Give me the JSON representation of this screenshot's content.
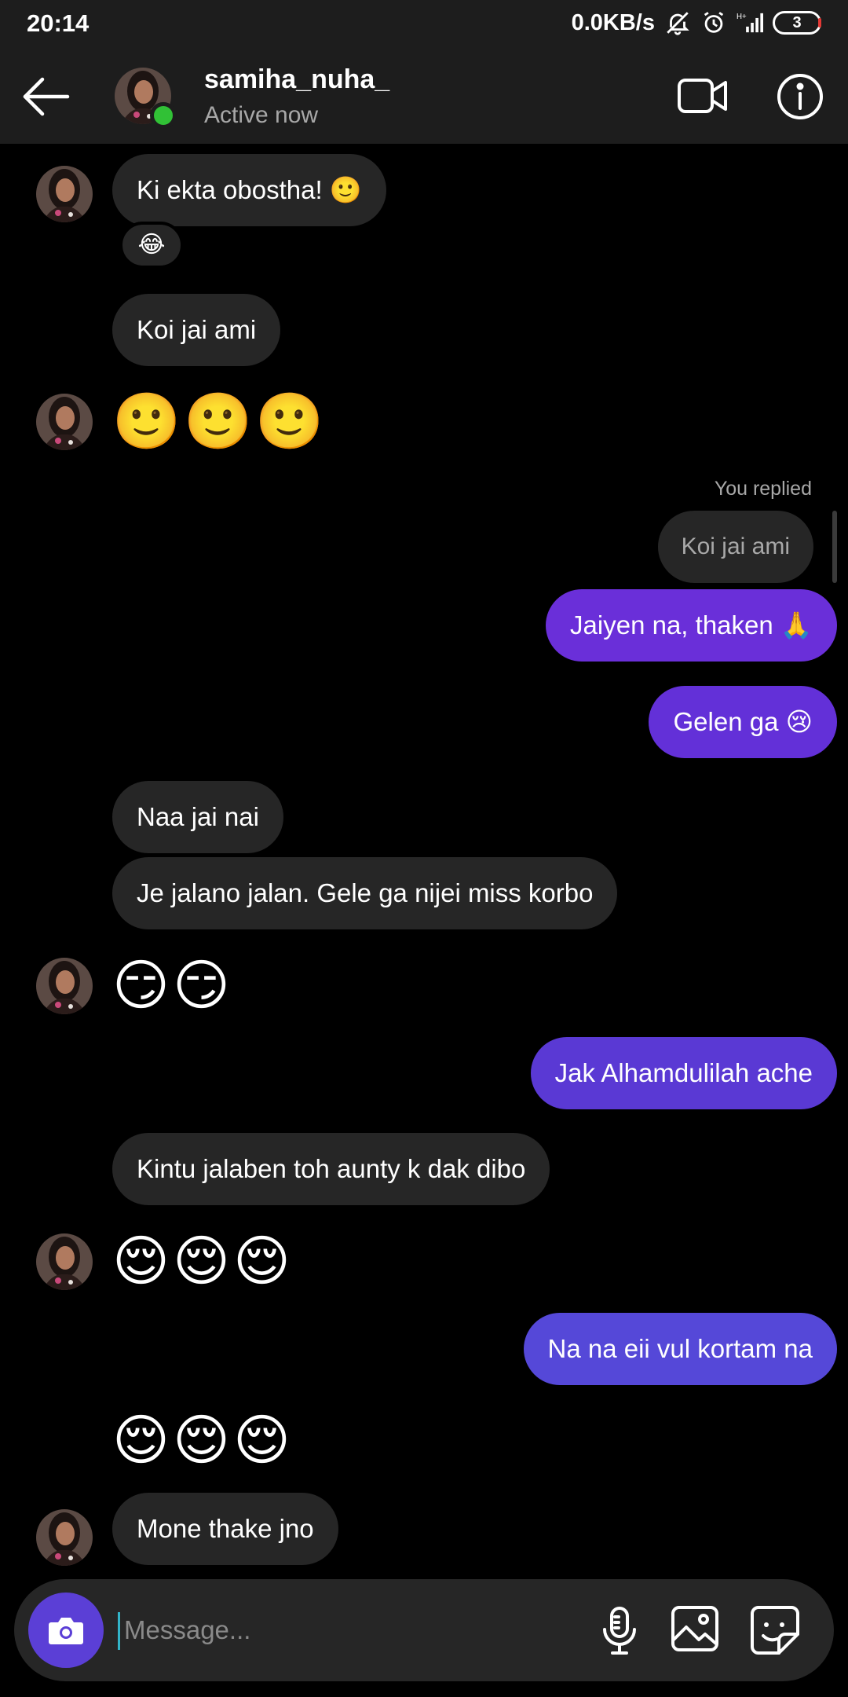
{
  "status_bar": {
    "time": "20:14",
    "net_speed": "0.0KB/s",
    "network_type": "H+",
    "battery": "3"
  },
  "header": {
    "username": "samiha_nuha_",
    "status": "Active now"
  },
  "thread": {
    "m1": {
      "text": "Ki ekta obostha! 🙂",
      "reaction": "😂"
    },
    "m2": {
      "text": "Koi jai ami"
    },
    "m3": {
      "text": "🙂🙂🙂"
    },
    "reply_label": "You replied",
    "reply_quote": "Koi jai ami",
    "m4": {
      "text": "Jaiyen na, thaken 🙏"
    },
    "m5": {
      "text": "Gelen ga 😢"
    },
    "m6": {
      "text": "Naa jai nai"
    },
    "m7": {
      "text": "Je jalano jalan. Gele ga nijei miss korbo"
    },
    "m8": {
      "text": "😏😏"
    },
    "m9": {
      "text": "Jak Alhamdulilah ache"
    },
    "m10": {
      "text": "Kintu jalaben toh aunty k dak dibo"
    },
    "m11": {
      "text": "😌😌😌"
    },
    "m12": {
      "text": "Na na eii vul kortam na"
    },
    "m13": {
      "text": "😌😌😌"
    },
    "m14": {
      "text": "Mone thake jno"
    }
  },
  "composer": {
    "placeholder": "Message..."
  },
  "colors": {
    "outgoing_bubble": "#5b3fd6",
    "incoming_bubble": "#262626",
    "online_dot": "#31c136"
  },
  "icons": [
    "back-arrow-icon",
    "video-call-icon",
    "info-icon",
    "camera-icon",
    "microphone-icon",
    "gallery-icon",
    "sticker-icon"
  ]
}
